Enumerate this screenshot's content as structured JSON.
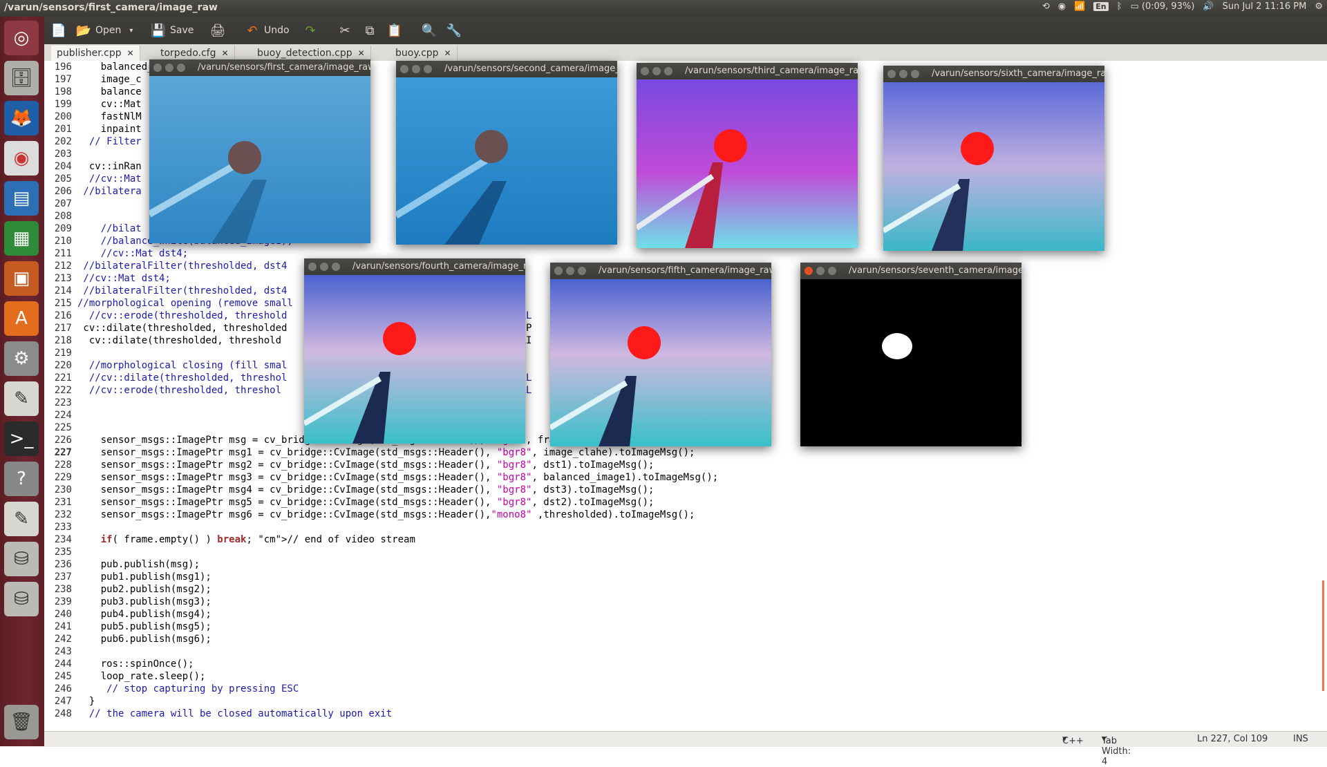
{
  "topbar": {
    "title": "/varun/sensors/first_camera/image_raw",
    "keyboard": "En",
    "battery": "(0:09, 93%)",
    "clock": "Sun Jul 2 11:16 PM"
  },
  "toolbar": {
    "open_label": "Open",
    "save_label": "Save",
    "undo_label": "Undo"
  },
  "tabs": [
    {
      "label": "publisher.cpp"
    },
    {
      "label": "torpedo.cfg"
    },
    {
      "label": "buoy_detection.cpp"
    },
    {
      "label": "buoy.cpp"
    }
  ],
  "editor": {
    "lines": [
      {
        "n": "196",
        "code": "    balanced_image1 = ..."
      },
      {
        "n": "197",
        "code": "    image_c"
      },
      {
        "n": "198",
        "code": "    balance"
      },
      {
        "n": "199",
        "code": "    cv::Mat"
      },
      {
        "n": "200",
        "code": "    fastNlM                                              1, balanc"
      },
      {
        "n": "201",
        "code": "    inpaint                                             ced_                            INT"
      },
      {
        "n": "202",
        "code": "  // Filter"
      },
      {
        "n": "203",
        "code": ""
      },
      {
        "n": "204",
        "code": "  cv::inRan                                            ded)"
      },
      {
        "n": "205",
        "code": "  //cv::Mat"
      },
      {
        "n": "206",
        "code": " //bilatera"
      },
      {
        "n": "207",
        "code": ""
      },
      {
        "n": "208",
        "code": ""
      },
      {
        "n": "209",
        "code": "    //bilat                                              , 8,"
      },
      {
        "n": "210",
        "code": "    //balance_white(balanced_image1);"
      },
      {
        "n": "211",
        "code": "    //cv::Mat dst4;"
      },
      {
        "n": "212",
        "code": " //bilateralFilter(thresholded, dst4"
      },
      {
        "n": "213",
        "code": " //cv::Mat dst4;"
      },
      {
        "n": "214",
        "code": " //bilateralFilter(thresholded, dst4"
      },
      {
        "n": "215",
        "code": "//morphological opening (remove small"
      },
      {
        "n": "216",
        "code": "  //cv::erode(thresholded, threshold                                      _ELL"
      },
      {
        "n": "217",
        "code": " cv::dilate(thresholded, thresholded                                      LLIP"
      },
      {
        "n": "218",
        "code": "  cv::dilate(thresholded, threshold                                       ELLI"
      },
      {
        "n": "219",
        "code": ""
      },
      {
        "n": "220",
        "code": "  //morphological closing (fill smal"
      },
      {
        "n": "221",
        "code": "  //cv::dilate(thresholded, threshol                                      H_EL"
      },
      {
        "n": "222",
        "code": "  //cv::erode(thresholded, threshol                                       _ELL"
      },
      {
        "n": "223",
        "code": ""
      },
      {
        "n": "224",
        "code": ""
      },
      {
        "n": "225",
        "code": ""
      },
      {
        "n": "226",
        "code": "    sensor_msgs::ImagePtr msg = cv_bridge::CvImage(std_msgs::Header(), \"bgr8\", frame).toImageMsg();"
      },
      {
        "n": "227",
        "code": "    sensor_msgs::ImagePtr msg1 = cv_bridge::CvImage(std_msgs::Header(), \"bgr8\", image_clahe).toImageMsg();"
      },
      {
        "n": "228",
        "code": "    sensor_msgs::ImagePtr msg2 = cv_bridge::CvImage(std_msgs::Header(), \"bgr8\", dst1).toImageMsg();"
      },
      {
        "n": "229",
        "code": "    sensor_msgs::ImagePtr msg3 = cv_bridge::CvImage(std_msgs::Header(), \"bgr8\", balanced_image1).toImageMsg();"
      },
      {
        "n": "230",
        "code": "    sensor_msgs::ImagePtr msg4 = cv_bridge::CvImage(std_msgs::Header(), \"bgr8\", dst3).toImageMsg();"
      },
      {
        "n": "231",
        "code": "    sensor_msgs::ImagePtr msg5 = cv_bridge::CvImage(std_msgs::Header(), \"bgr8\", dst2).toImageMsg();"
      },
      {
        "n": "232",
        "code": "    sensor_msgs::ImagePtr msg6 = cv_bridge::CvImage(std_msgs::Header(),\"mono8\" ,thresholded).toImageMsg();"
      },
      {
        "n": "233",
        "code": ""
      },
      {
        "n": "234",
        "code": "    if( frame.empty() ) break; // end of video stream"
      },
      {
        "n": "235",
        "code": ""
      },
      {
        "n": "236",
        "code": "    pub.publish(msg);"
      },
      {
        "n": "237",
        "code": "    pub1.publish(msg1);"
      },
      {
        "n": "238",
        "code": "    pub2.publish(msg2);"
      },
      {
        "n": "239",
        "code": "    pub3.publish(msg3);"
      },
      {
        "n": "240",
        "code": "    pub4.publish(msg4);"
      },
      {
        "n": "241",
        "code": "    pub5.publish(msg5);"
      },
      {
        "n": "242",
        "code": "    pub6.publish(msg6);"
      },
      {
        "n": "243",
        "code": ""
      },
      {
        "n": "244",
        "code": "    ros::spinOnce();"
      },
      {
        "n": "245",
        "code": "    loop_rate.sleep();"
      },
      {
        "n": "246",
        "code": "     // stop capturing by pressing ESC"
      },
      {
        "n": "247",
        "code": "  }"
      },
      {
        "n": "248",
        "code": "  // the camera will be closed automatically upon exit"
      }
    ]
  },
  "windows": [
    {
      "title": "/varun/sensors/first_camera/image_raw"
    },
    {
      "title": "/varun/sensors/second_camera/image_raw"
    },
    {
      "title": "/varun/sensors/third_camera/image_raw"
    },
    {
      "title": "/varun/sensors/sixth_camera/image_raw"
    },
    {
      "title": "/varun/sensors/fourth_camera/image_raw"
    },
    {
      "title": "/varun/sensors/fifth_camera/image_raw"
    },
    {
      "title": "/varun/sensors/seventh_camera/image_raw"
    }
  ],
  "statusbar": {
    "language": "C++",
    "tab_width": "Tab Width: 4",
    "position": "Ln 227, Col 109",
    "mode": "INS"
  },
  "colors": {
    "launcher": "#6e2530",
    "comment": "#1a1ab0",
    "string": "#cc00aa",
    "keyword": "#a52a2a",
    "buoy_red": "#ff1a1a"
  }
}
